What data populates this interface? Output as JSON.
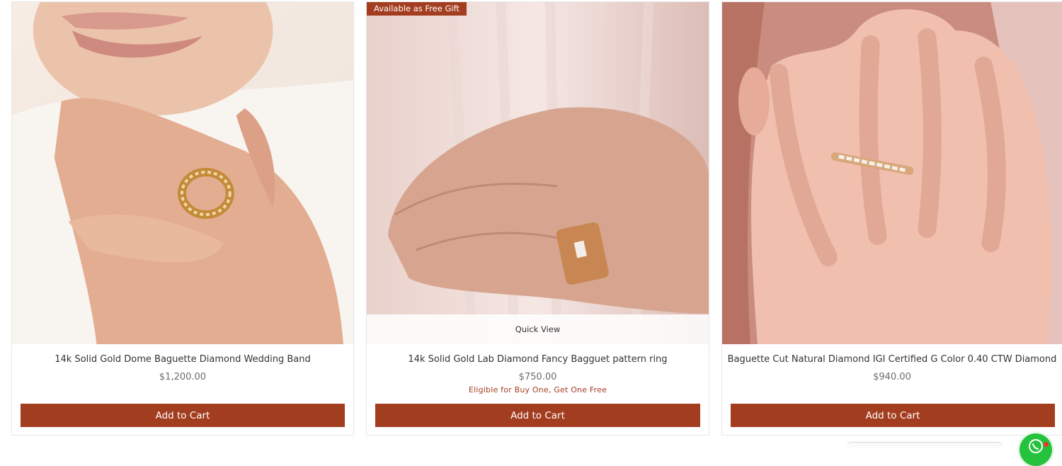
{
  "products": [
    {
      "title": "14k Solid Gold Dome Baguette Diamond Wedding Band",
      "price": "$1,200.00",
      "button": "Add to Cart"
    },
    {
      "badge": "Available as Free Gift",
      "quick_view": "Quick View",
      "title": "14k Solid Gold Lab Diamond Fancy Bagguet pattern ring",
      "price": "$750.00",
      "promo": "Eligible for Buy One, Get One Free",
      "button": "Add to Cart"
    },
    {
      "title": "Baguette Cut Natural Diamond IGI Certified G Color 0.40 CTW Diamond",
      "price": "$940.00",
      "button": "Add to Cart"
    }
  ],
  "colors": {
    "accent": "#a33d1f",
    "chat": "#25c23d"
  },
  "icons": [
    "whatsapp-chat-icon"
  ]
}
